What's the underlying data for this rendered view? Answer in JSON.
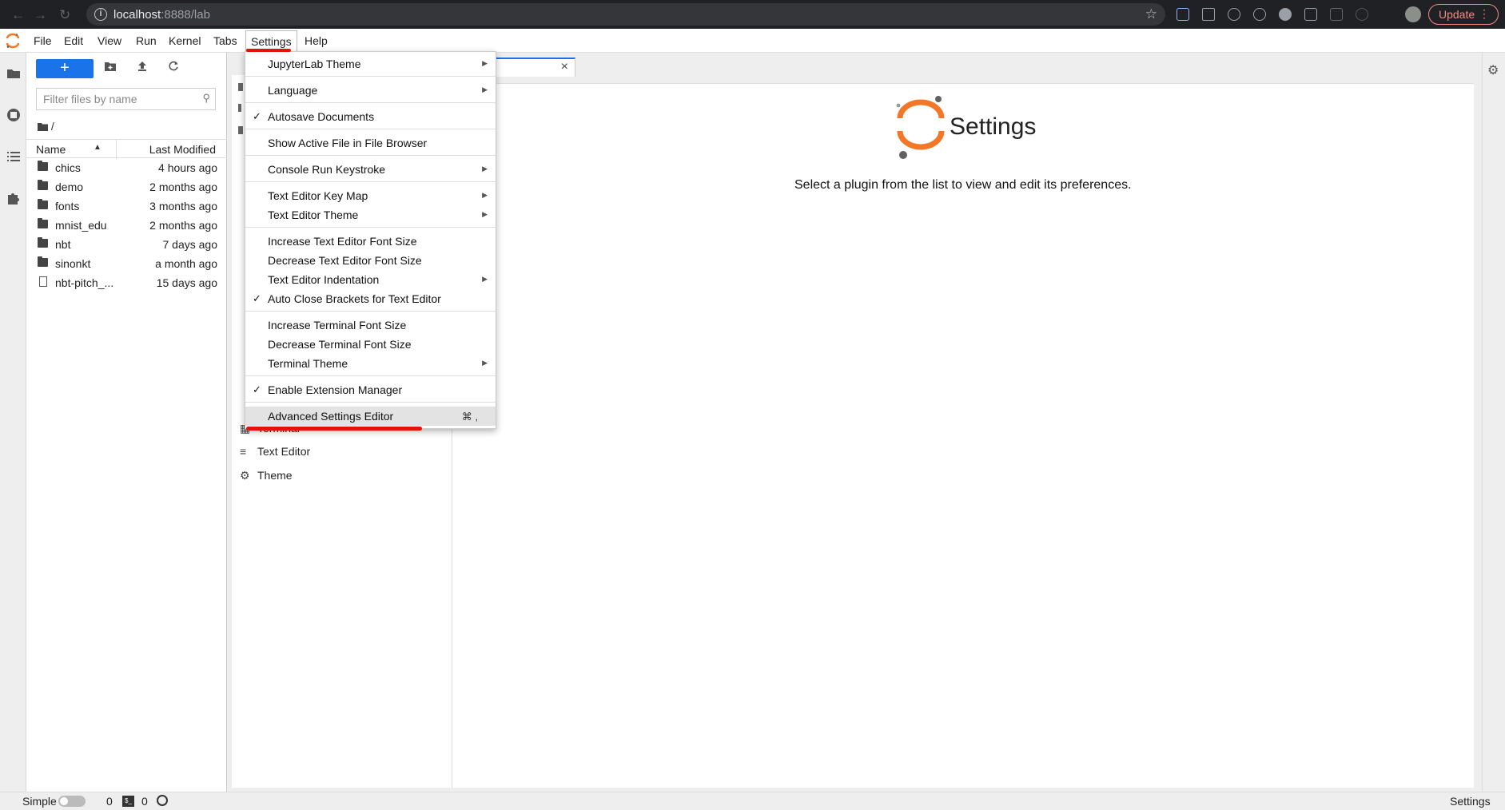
{
  "browser": {
    "url_host": "localhost",
    "url_rest": ":8888/lab",
    "update_label": "Update"
  },
  "menubar": {
    "items": [
      "File",
      "Edit",
      "View",
      "Run",
      "Kernel",
      "Tabs",
      "Settings",
      "Help"
    ]
  },
  "filebrowser": {
    "filter_placeholder": "Filter files by name",
    "crumb": "/",
    "col_name": "Name",
    "col_modified": "Last Modified",
    "files": [
      {
        "name": "chics",
        "modified": "4 hours ago",
        "type": "folder"
      },
      {
        "name": "demo",
        "modified": "2 months ago",
        "type": "folder"
      },
      {
        "name": "fonts",
        "modified": "3 months ago",
        "type": "folder"
      },
      {
        "name": "mnist_edu",
        "modified": "2 months ago",
        "type": "folder"
      },
      {
        "name": "nbt",
        "modified": "7 days ago",
        "type": "folder"
      },
      {
        "name": "sinonkt",
        "modified": "a month ago",
        "type": "folder"
      },
      {
        "name": "nbt-pitch_...",
        "modified": "15 days ago",
        "type": "file"
      }
    ]
  },
  "launcher": {
    "items": [
      {
        "label": "Terminal",
        "icon": "terminal-icon"
      },
      {
        "label": "Text Editor",
        "icon": "text-editor-icon"
      },
      {
        "label": "Theme",
        "icon": "gear-icon"
      }
    ]
  },
  "settings_view": {
    "title": "Settings",
    "prompt": "Select a plugin from the list to view and edit its preferences."
  },
  "settings_menu": {
    "items": [
      {
        "label": "JupyterLab Theme",
        "submenu": true
      },
      {
        "label": "Language",
        "submenu": true
      },
      {
        "label": "Autosave Documents",
        "checked": true
      },
      {
        "label": "Show Active File in File Browser"
      },
      {
        "label": "Console Run Keystroke",
        "submenu": true
      },
      {
        "label": "Text Editor Key Map",
        "submenu": true
      },
      {
        "label": "Text Editor Theme",
        "submenu": true
      },
      {
        "label": "Increase Text Editor Font Size"
      },
      {
        "label": "Decrease Text Editor Font Size"
      },
      {
        "label": "Text Editor Indentation",
        "submenu": true
      },
      {
        "label": "Auto Close Brackets for Text Editor",
        "checked": true
      },
      {
        "label": "Increase Terminal Font Size"
      },
      {
        "label": "Decrease Terminal Font Size"
      },
      {
        "label": "Terminal Theme",
        "submenu": true
      },
      {
        "label": "Enable Extension Manager",
        "checked": true
      },
      {
        "label": "Advanced Settings Editor",
        "shortcut": "⌘ ,",
        "active": true
      }
    ]
  },
  "statusbar": {
    "simple_label": "Simple",
    "terminals_count": "0",
    "kernels_count": "0",
    "right_label": "Settings"
  },
  "colors": {
    "accent": "#1a73e8",
    "jupyter_orange": "#f37726",
    "annotation_red": "#e3120b"
  }
}
